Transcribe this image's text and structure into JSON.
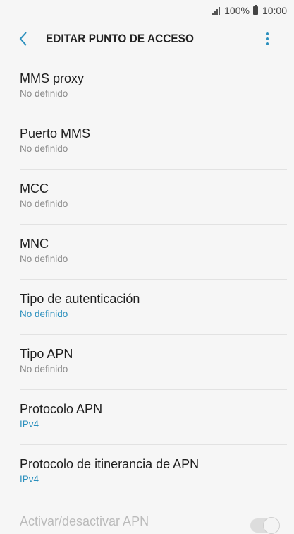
{
  "status_bar": {
    "battery": "100%",
    "time": "10:00"
  },
  "header": {
    "title": "EDITAR PUNTO DE ACCESO"
  },
  "accent_color": "#2a8fbd",
  "items": [
    {
      "label": "MMS proxy",
      "value": "No definido",
      "accent": false
    },
    {
      "label": "Puerto MMS",
      "value": "No definido",
      "accent": false
    },
    {
      "label": "MCC",
      "value": "No definido",
      "accent": false
    },
    {
      "label": "MNC",
      "value": "No definido",
      "accent": false
    },
    {
      "label": "Tipo de autenticación",
      "value": "No definido",
      "accent": true
    },
    {
      "label": "Tipo APN",
      "value": "No definido",
      "accent": false
    },
    {
      "label": "Protocolo APN",
      "value": "IPv4",
      "accent": true
    },
    {
      "label": "Protocolo de itinerancia de APN",
      "value": "IPv4",
      "accent": true
    }
  ],
  "toggle_row": {
    "label": "Activar/desactivar APN"
  }
}
